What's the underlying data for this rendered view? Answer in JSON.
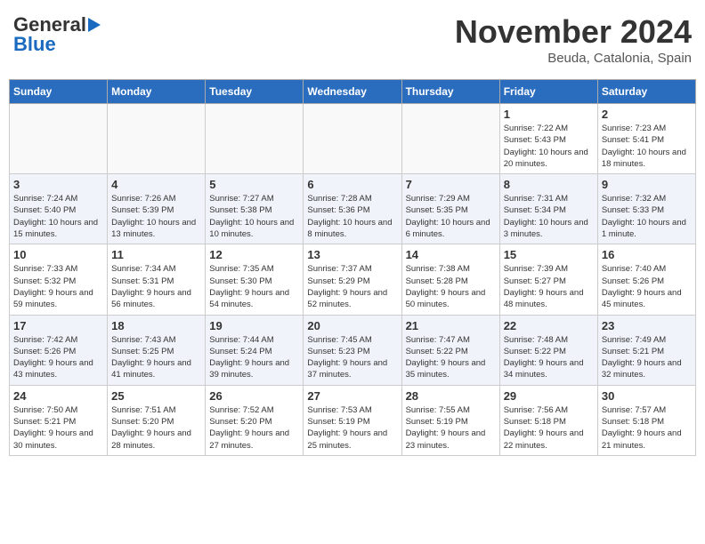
{
  "header": {
    "logo_line1": "General",
    "logo_line2": "Blue",
    "month": "November 2024",
    "location": "Beuda, Catalonia, Spain"
  },
  "weekdays": [
    "Sunday",
    "Monday",
    "Tuesday",
    "Wednesday",
    "Thursday",
    "Friday",
    "Saturday"
  ],
  "weeks": [
    [
      {
        "day": "",
        "info": ""
      },
      {
        "day": "",
        "info": ""
      },
      {
        "day": "",
        "info": ""
      },
      {
        "day": "",
        "info": ""
      },
      {
        "day": "",
        "info": ""
      },
      {
        "day": "1",
        "info": "Sunrise: 7:22 AM\nSunset: 5:43 PM\nDaylight: 10 hours and 20 minutes."
      },
      {
        "day": "2",
        "info": "Sunrise: 7:23 AM\nSunset: 5:41 PM\nDaylight: 10 hours and 18 minutes."
      }
    ],
    [
      {
        "day": "3",
        "info": "Sunrise: 7:24 AM\nSunset: 5:40 PM\nDaylight: 10 hours and 15 minutes."
      },
      {
        "day": "4",
        "info": "Sunrise: 7:26 AM\nSunset: 5:39 PM\nDaylight: 10 hours and 13 minutes."
      },
      {
        "day": "5",
        "info": "Sunrise: 7:27 AM\nSunset: 5:38 PM\nDaylight: 10 hours and 10 minutes."
      },
      {
        "day": "6",
        "info": "Sunrise: 7:28 AM\nSunset: 5:36 PM\nDaylight: 10 hours and 8 minutes."
      },
      {
        "day": "7",
        "info": "Sunrise: 7:29 AM\nSunset: 5:35 PM\nDaylight: 10 hours and 6 minutes."
      },
      {
        "day": "8",
        "info": "Sunrise: 7:31 AM\nSunset: 5:34 PM\nDaylight: 10 hours and 3 minutes."
      },
      {
        "day": "9",
        "info": "Sunrise: 7:32 AM\nSunset: 5:33 PM\nDaylight: 10 hours and 1 minute."
      }
    ],
    [
      {
        "day": "10",
        "info": "Sunrise: 7:33 AM\nSunset: 5:32 PM\nDaylight: 9 hours and 59 minutes."
      },
      {
        "day": "11",
        "info": "Sunrise: 7:34 AM\nSunset: 5:31 PM\nDaylight: 9 hours and 56 minutes."
      },
      {
        "day": "12",
        "info": "Sunrise: 7:35 AM\nSunset: 5:30 PM\nDaylight: 9 hours and 54 minutes."
      },
      {
        "day": "13",
        "info": "Sunrise: 7:37 AM\nSunset: 5:29 PM\nDaylight: 9 hours and 52 minutes."
      },
      {
        "day": "14",
        "info": "Sunrise: 7:38 AM\nSunset: 5:28 PM\nDaylight: 9 hours and 50 minutes."
      },
      {
        "day": "15",
        "info": "Sunrise: 7:39 AM\nSunset: 5:27 PM\nDaylight: 9 hours and 48 minutes."
      },
      {
        "day": "16",
        "info": "Sunrise: 7:40 AM\nSunset: 5:26 PM\nDaylight: 9 hours and 45 minutes."
      }
    ],
    [
      {
        "day": "17",
        "info": "Sunrise: 7:42 AM\nSunset: 5:26 PM\nDaylight: 9 hours and 43 minutes."
      },
      {
        "day": "18",
        "info": "Sunrise: 7:43 AM\nSunset: 5:25 PM\nDaylight: 9 hours and 41 minutes."
      },
      {
        "day": "19",
        "info": "Sunrise: 7:44 AM\nSunset: 5:24 PM\nDaylight: 9 hours and 39 minutes."
      },
      {
        "day": "20",
        "info": "Sunrise: 7:45 AM\nSunset: 5:23 PM\nDaylight: 9 hours and 37 minutes."
      },
      {
        "day": "21",
        "info": "Sunrise: 7:47 AM\nSunset: 5:22 PM\nDaylight: 9 hours and 35 minutes."
      },
      {
        "day": "22",
        "info": "Sunrise: 7:48 AM\nSunset: 5:22 PM\nDaylight: 9 hours and 34 minutes."
      },
      {
        "day": "23",
        "info": "Sunrise: 7:49 AM\nSunset: 5:21 PM\nDaylight: 9 hours and 32 minutes."
      }
    ],
    [
      {
        "day": "24",
        "info": "Sunrise: 7:50 AM\nSunset: 5:21 PM\nDaylight: 9 hours and 30 minutes."
      },
      {
        "day": "25",
        "info": "Sunrise: 7:51 AM\nSunset: 5:20 PM\nDaylight: 9 hours and 28 minutes."
      },
      {
        "day": "26",
        "info": "Sunrise: 7:52 AM\nSunset: 5:20 PM\nDaylight: 9 hours and 27 minutes."
      },
      {
        "day": "27",
        "info": "Sunrise: 7:53 AM\nSunset: 5:19 PM\nDaylight: 9 hours and 25 minutes."
      },
      {
        "day": "28",
        "info": "Sunrise: 7:55 AM\nSunset: 5:19 PM\nDaylight: 9 hours and 23 minutes."
      },
      {
        "day": "29",
        "info": "Sunrise: 7:56 AM\nSunset: 5:18 PM\nDaylight: 9 hours and 22 minutes."
      },
      {
        "day": "30",
        "info": "Sunrise: 7:57 AM\nSunset: 5:18 PM\nDaylight: 9 hours and 21 minutes."
      }
    ]
  ]
}
